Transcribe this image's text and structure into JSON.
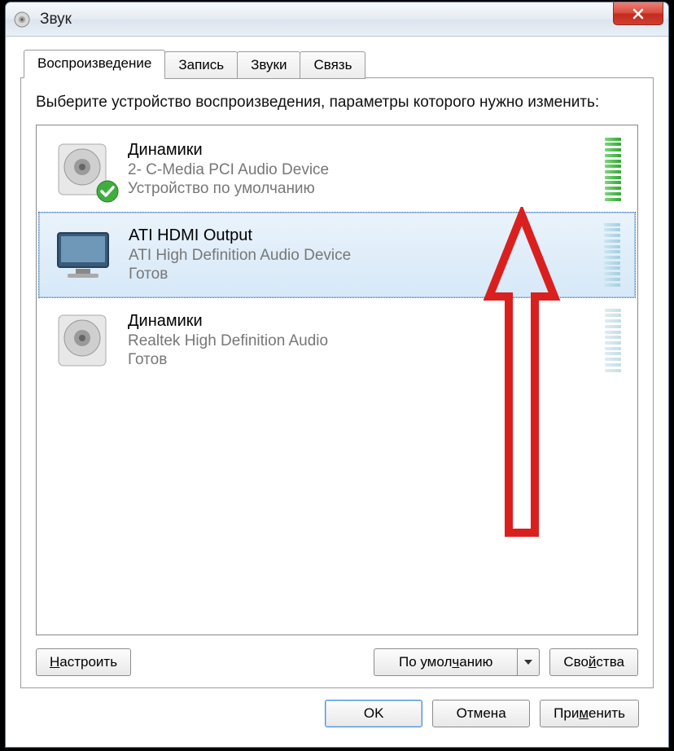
{
  "window": {
    "title": "Звук"
  },
  "tabs": [
    {
      "label": "Воспроизведение",
      "active": true
    },
    {
      "label": "Запись",
      "active": false
    },
    {
      "label": "Звуки",
      "active": false
    },
    {
      "label": "Связь",
      "active": false
    }
  ],
  "instruction": "Выберите устройство воспроизведения, параметры которого нужно изменить:",
  "devices": [
    {
      "name": "Динамики",
      "desc": "2- C-Media PCI Audio Device",
      "status": "Устройство по умолчанию",
      "icon": "speaker",
      "default": true,
      "selected": false,
      "meter": "green"
    },
    {
      "name": "ATI HDMI Output",
      "desc": "ATI High Definition Audio Device",
      "status": "Готов",
      "icon": "monitor",
      "default": false,
      "selected": true,
      "meter": "blue"
    },
    {
      "name": "Динамики",
      "desc": "Realtek High Definition Audio",
      "status": "Готов",
      "icon": "speaker",
      "default": false,
      "selected": false,
      "meter": "blue-dim"
    }
  ],
  "buttons": {
    "configure_pre": "Н",
    "configure_post": "астроить",
    "default_pre": "По умол",
    "default_u": "ч",
    "default_post": "анию",
    "properties_pre": "Сво",
    "properties_u": "й",
    "properties_post": "ства",
    "ok": "OK",
    "cancel": "Отмена",
    "apply_pre": "При",
    "apply_u": "м",
    "apply_post": "енить"
  }
}
